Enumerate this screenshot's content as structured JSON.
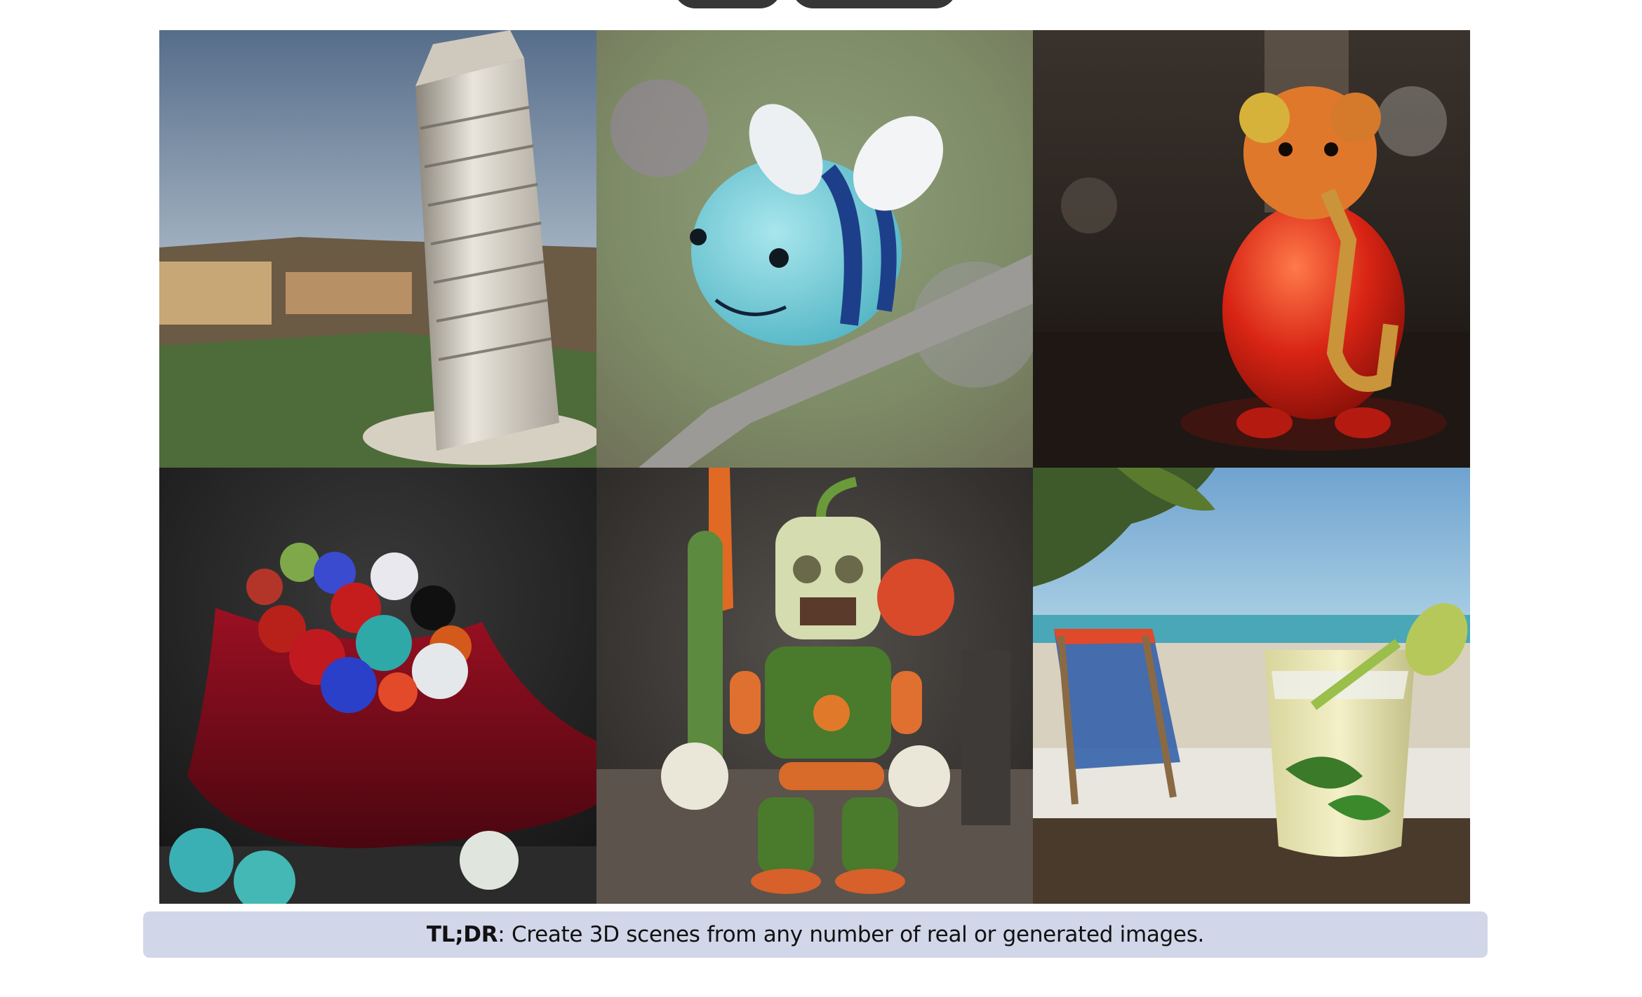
{
  "nav": {
    "buttons": [
      {
        "label": ""
      },
      {
        "label": ""
      }
    ]
  },
  "gallery": {
    "tiles": [
      {
        "subject": "leaning-tower-image"
      },
      {
        "subject": "crochet-bee-image"
      },
      {
        "subject": "gummy-bear-saxophone-image"
      },
      {
        "subject": "marbles-velvet-bag-image"
      },
      {
        "subject": "vegetable-robot-image"
      },
      {
        "subject": "mojito-beach-image"
      }
    ]
  },
  "caption": {
    "bold_text": "TL;DR",
    "text": ": Create 3D scenes from any number of real or generated images."
  },
  "colors": {
    "caption_background": "#d2d6e9",
    "pill_background": "#363636"
  }
}
